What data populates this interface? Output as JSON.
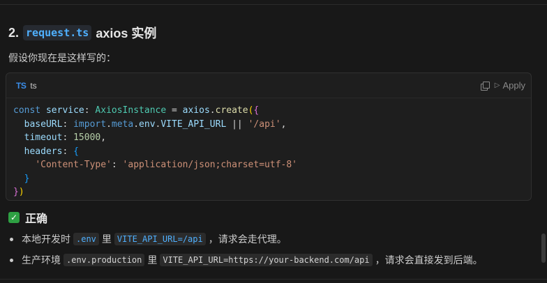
{
  "heading": {
    "number": "2.",
    "code": "request.ts",
    "text": "axios 实例"
  },
  "intro": "假设你现在是这样写的：",
  "code_block": {
    "language_icon": "TS",
    "language": "ts",
    "copy_icon": "copy-icon",
    "apply_label": "Apply",
    "lines": [
      [
        "const",
        " ",
        "service",
        ": ",
        "AxiosInstance",
        " = ",
        "axios",
        ".",
        "create",
        "(",
        "{"
      ],
      [
        "  baseURL",
        ": ",
        "import",
        ".",
        "meta",
        ".",
        "env",
        ".",
        "VITE_API_URL",
        " || ",
        "'/api'",
        ","
      ],
      [
        "  timeout",
        ": ",
        "15000",
        ","
      ],
      [
        "  headers",
        ": ",
        "{"
      ],
      [
        "    ",
        "'Content-Type'",
        ": ",
        "'application/json;charset=utf-8'"
      ],
      [
        "  ",
        "}"
      ],
      [
        "}",
        ")"
      ]
    ]
  },
  "check": {
    "icon": "check-icon",
    "label": "正确"
  },
  "bullets": [
    {
      "before": "本地开发时",
      "code1": ".env",
      "middle": "里",
      "code2": "VITE_API_URL=/api",
      "after": "，请求会走代理。"
    },
    {
      "before": "生产环境",
      "code1": ".env.production",
      "middle": "里",
      "code2": "VITE_API_URL=https://your-backend.com/api",
      "after": "，请求会直接发到后端。"
    }
  ]
}
